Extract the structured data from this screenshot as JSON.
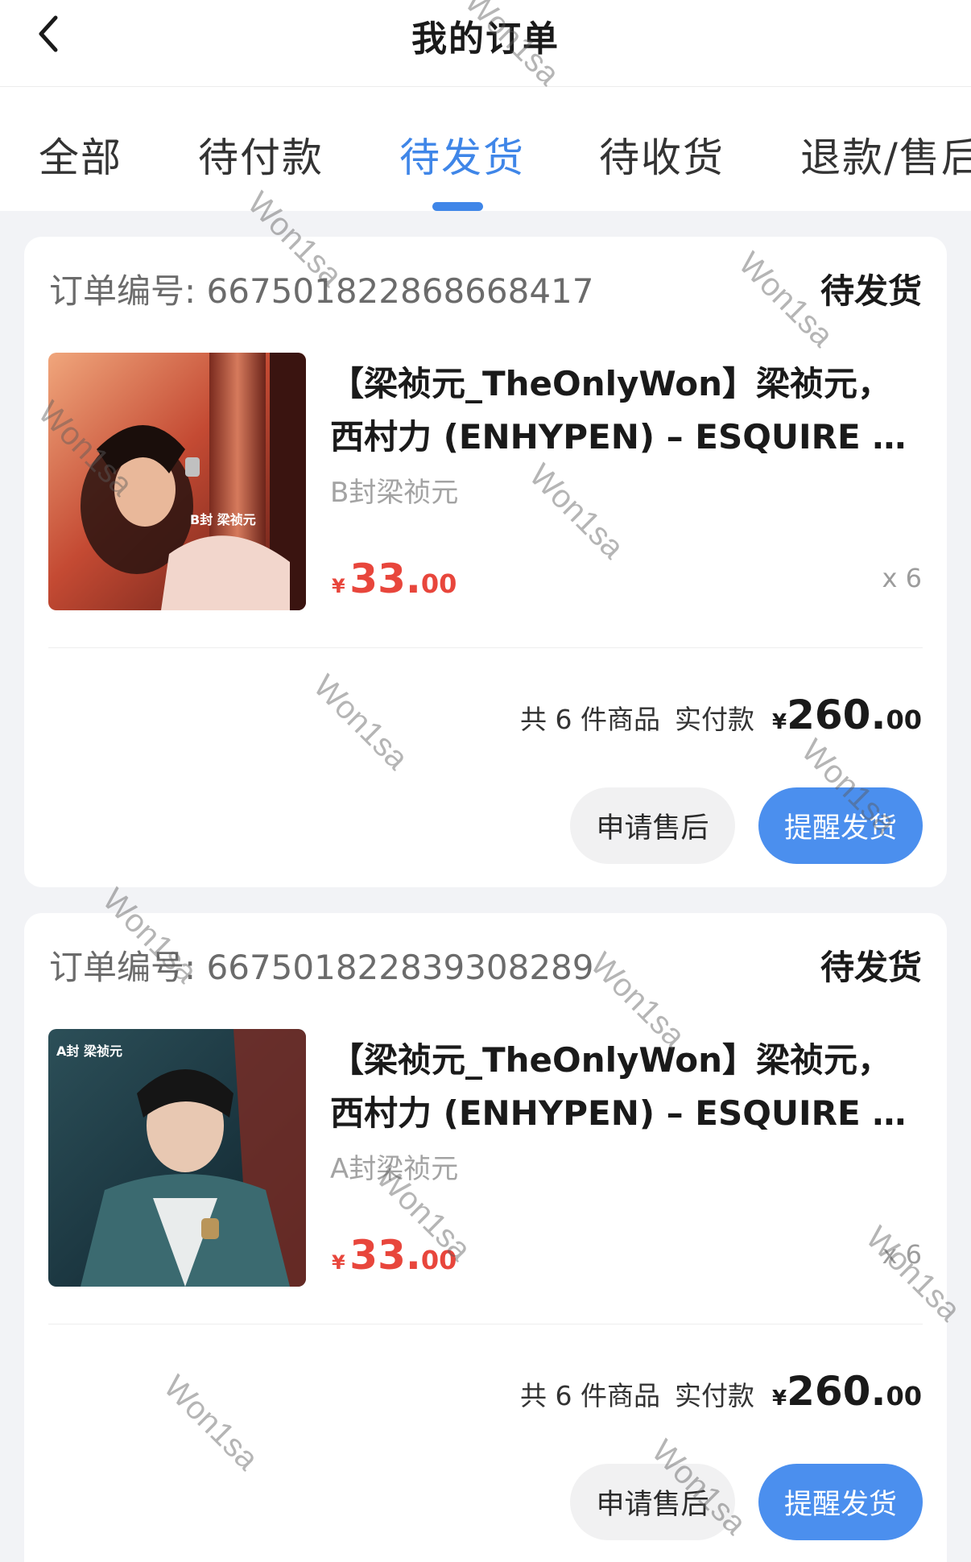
{
  "header": {
    "title": "我的订单"
  },
  "tabs": [
    {
      "label": "全部"
    },
    {
      "label": "待付款"
    },
    {
      "label": "待发货"
    },
    {
      "label": "待收货"
    },
    {
      "label": "退款/售后"
    }
  ],
  "active_tab": "待发货",
  "orders": [
    {
      "order_no": "订单编号: 667501822868668417",
      "status": "待发货",
      "product": {
        "title_line1": "【梁祯元_TheOnlyWon】梁祯元，",
        "title_line2": "西村力 (ENHYPEN) – ESQUIRE …",
        "variant": "B封梁祯元",
        "image_label": "B封 梁祯元",
        "price_currency": "¥",
        "price_int": "33.",
        "price_dec": "00",
        "quantity": "x 6"
      },
      "summary": {
        "count_text": "共 6 件商品",
        "paid_label": "实付款",
        "currency": "¥",
        "total_int": "260.",
        "total_dec": "00"
      },
      "buttons": {
        "after_sale": "申请售后",
        "remind": "提醒发货"
      }
    },
    {
      "order_no": "订单编号: 667501822839308289",
      "status": "待发货",
      "product": {
        "title_line1": "【梁祯元_TheOnlyWon】梁祯元，",
        "title_line2": "西村力 (ENHYPEN) – ESQUIRE …",
        "variant": "A封梁祯元",
        "image_label": "A封 梁祯元",
        "price_currency": "¥",
        "price_int": "33.",
        "price_dec": "00",
        "quantity": "x 6"
      },
      "summary": {
        "count_text": "共 6 件商品",
        "paid_label": "实付款",
        "currency": "¥",
        "total_int": "260.",
        "total_dec": "00"
      },
      "buttons": {
        "after_sale": "申请售后",
        "remind": "提醒发货"
      }
    }
  ],
  "watermark": "Won1sa",
  "colors": {
    "accent": "#3f86e8",
    "price": "#e8463c",
    "primary_button": "#4b8fee"
  }
}
